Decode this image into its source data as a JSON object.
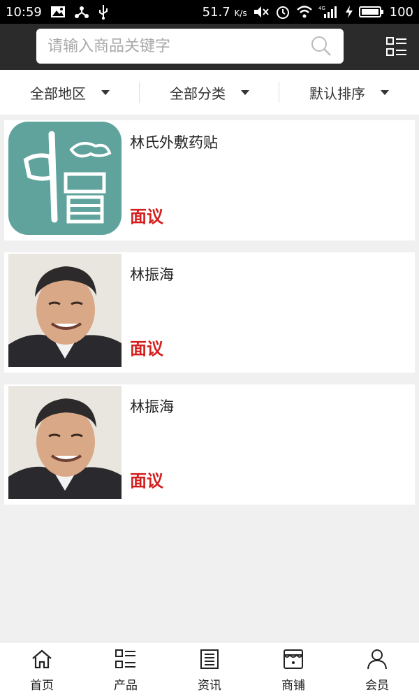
{
  "status_bar": {
    "time": "10:59",
    "speed": "51.7",
    "speed_unit": "K/s",
    "network": "4G",
    "battery": "100"
  },
  "search": {
    "placeholder": "请输入商品关键字",
    "value": ""
  },
  "filters": [
    {
      "label": "全部地区"
    },
    {
      "label": "全部分类"
    },
    {
      "label": "默认排序"
    }
  ],
  "products": [
    {
      "name": "林氏外敷药贴",
      "price": "面议",
      "thumb_icon": "zhongyi-logo-image"
    },
    {
      "name": "林振海",
      "price": "面议",
      "thumb_icon": "portrait-photo"
    },
    {
      "name": "林振海",
      "price": "面议",
      "thumb_icon": "portrait-photo"
    }
  ],
  "nav": [
    {
      "label": "首页",
      "icon": "home-icon"
    },
    {
      "label": "产品",
      "icon": "list-icon"
    },
    {
      "label": "资讯",
      "icon": "news-icon"
    },
    {
      "label": "商铺",
      "icon": "shop-icon"
    },
    {
      "label": "会员",
      "icon": "user-icon"
    }
  ],
  "colors": {
    "header_bg": "#2b2b2b",
    "price": "#d41e1e",
    "logo_bg": "#5fa39c"
  }
}
